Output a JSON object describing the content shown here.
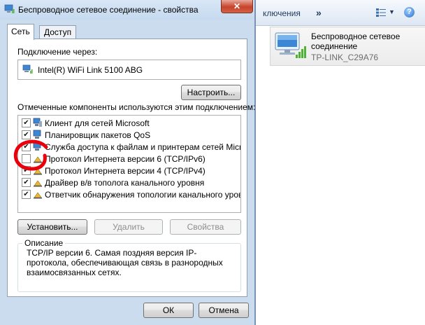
{
  "background_window": {
    "toolbar_label": "ключения",
    "chevron": "»",
    "view_arrow": "▼",
    "help": "?",
    "connection_name": "Беспроводное сетевое соединение",
    "connection_network": "TP-LINK_C29A76"
  },
  "dialog": {
    "title": "Беспроводное сетевое соединение - свойства",
    "close": "✕",
    "tabs": [
      {
        "label": "Сеть"
      },
      {
        "label": "Доступ"
      }
    ],
    "connect_using_label": "Подключение через:",
    "adapter_name": "Intel(R) WiFi Link 5100 ABG",
    "configure_button": "Настроить...",
    "components_label": "Отмеченные компоненты используются этим подключением:",
    "components": [
      {
        "checked": "✔",
        "label": "Клиент для сетей Microsoft"
      },
      {
        "checked": "✔",
        "label": "Планировщик пакетов QoS"
      },
      {
        "checked": "✔",
        "label": "Служба доступа к файлам и принтерам сетей Micro..."
      },
      {
        "checked": "",
        "label": "Протокол Интернета версии 6 (TCP/IPv6)"
      },
      {
        "checked": "✔",
        "label": "Протокол Интернета версии 4 (TCP/IPv4)"
      },
      {
        "checked": "✔",
        "label": "Драйвер в/в тополога канального уровня"
      },
      {
        "checked": "✔",
        "label": "Ответчик обнаружения топологии канального уровня"
      }
    ],
    "install_button": "Установить...",
    "remove_button": "Удалить",
    "properties_button": "Свойства",
    "description_legend": "Описание",
    "description_text": "TCP/IP версии 6. Самая поздняя версия IP-протокола, обеспечивающая связь в разнородных взаимосвязанных сетях.",
    "ok_button": "ОК",
    "cancel_button": "Отмена"
  },
  "colors": {
    "dialog_frame": "#cbdcee",
    "annotation": "#e8000b",
    "close_button": "#c7432a"
  }
}
